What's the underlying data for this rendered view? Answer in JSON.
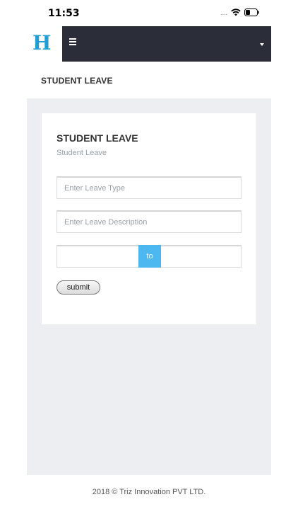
{
  "status_bar": {
    "time": "11:53",
    "signal_text": "....",
    "icons": [
      "wifi-icon",
      "battery-icon"
    ]
  },
  "header": {
    "logo": "H",
    "logo_color": "#1e9fd6",
    "navbar_color": "#2b2e38",
    "icons": [
      "menu-icon",
      "caret-down-icon"
    ]
  },
  "page": {
    "title": "STUDENT LEAVE"
  },
  "card": {
    "title": "STUDENT LEAVE",
    "subtitle": "Student Leave"
  },
  "form": {
    "leave_type_placeholder": "Enter Leave Type",
    "leave_type_value": "",
    "leave_description_placeholder": "Enter Leave Description",
    "leave_description_value": "",
    "date_from_value": "",
    "date_separator": "to",
    "date_to_value": "",
    "submit_label": "submit",
    "accent_color": "#4db8f0"
  },
  "footer": {
    "text": "2018 © Triz Innovation PVT LTD."
  }
}
